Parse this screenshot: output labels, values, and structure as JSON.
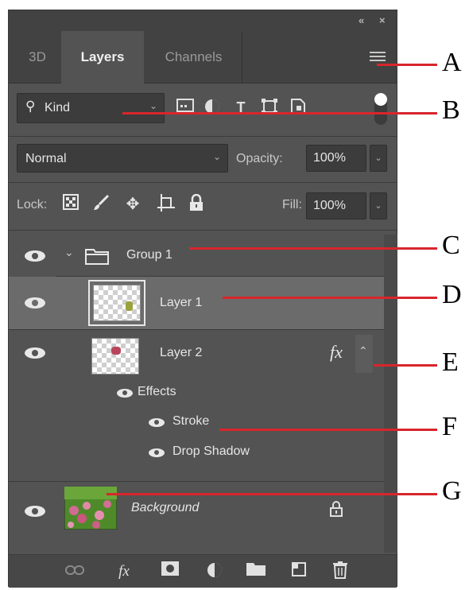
{
  "titlebar": {
    "collapse_glyph": "«",
    "close_glyph": "×"
  },
  "tabs": [
    {
      "label": "3D",
      "active": false
    },
    {
      "label": "Layers",
      "active": true
    },
    {
      "label": "Channels",
      "active": false
    }
  ],
  "filter": {
    "kind_label": "Kind",
    "icons": [
      "pixel-filter-icon",
      "adjustment-filter-icon",
      "type-filter-icon",
      "shape-filter-icon",
      "smart-object-filter-icon"
    ]
  },
  "blend": {
    "mode": "Normal",
    "opacity_label": "Opacity:",
    "opacity_value": "100%"
  },
  "lock": {
    "label": "Lock:",
    "fill_label": "Fill:",
    "fill_value": "100%"
  },
  "layers": {
    "group": {
      "name": "Group 1"
    },
    "layer1": {
      "name": "Layer 1"
    },
    "layer2": {
      "name": "Layer 2",
      "fx": "fx",
      "effects_label": "Effects",
      "effects": [
        "Stroke",
        "Drop Shadow"
      ]
    },
    "background": {
      "name": "Background"
    }
  },
  "callouts": [
    "A",
    "B",
    "C",
    "D",
    "E",
    "F",
    "G"
  ],
  "colors": {
    "panel": "#535353",
    "dark": "#424242",
    "selected": "#6b6b6b",
    "callout_line": "#d8262c"
  }
}
